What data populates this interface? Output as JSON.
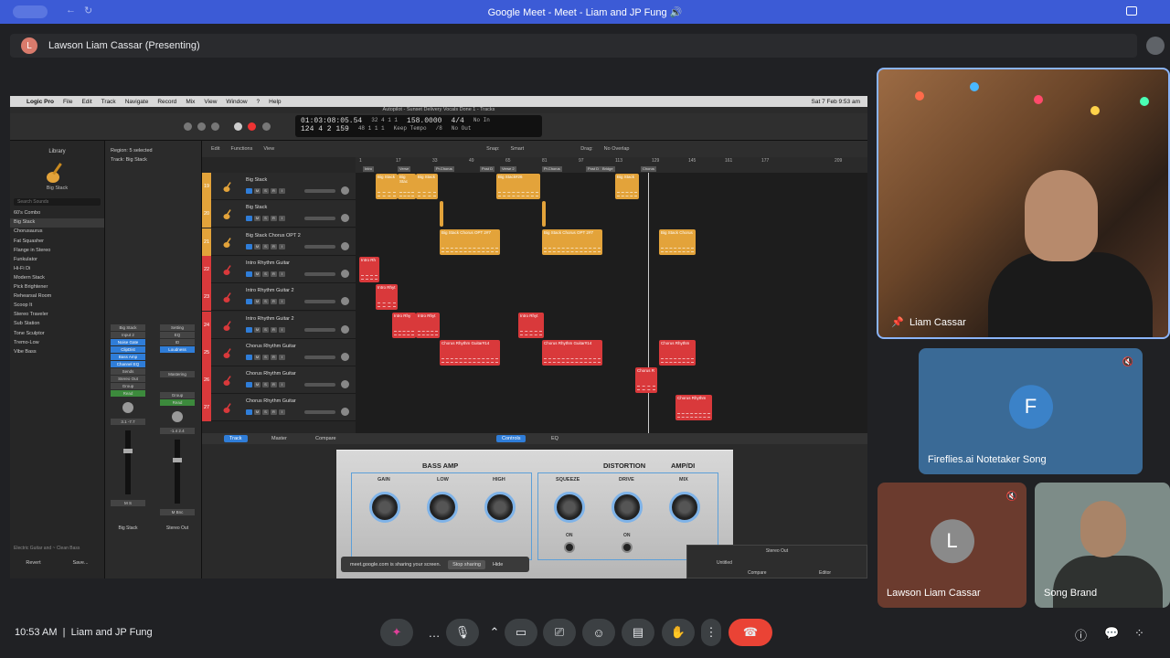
{
  "browser": {
    "title": "Google Meet - Meet - Liam and JP Fung 🔊"
  },
  "presenting": {
    "initial": "L",
    "text": "Lawson Liam Cassar (Presenting)"
  },
  "mac_menu": {
    "app": "Logic Pro",
    "items": [
      "File",
      "Edit",
      "Track",
      "Navigate",
      "Record",
      "Mix",
      "View",
      "Window",
      "?",
      "Help"
    ],
    "datetime": "Sat 7 Feb 9:53 am"
  },
  "logic": {
    "window_title": "Autopilot - Sunset Delivery Vocals Done 1 - Tracks",
    "lcd": {
      "time": "01:03:08:05.54",
      "bars": "124  4  2  159",
      "pos1": "32  4  1  1",
      "pos2": "48  1  1  1",
      "tempo": "158.0000",
      "tempo_mode": "Keep Tempo",
      "sig": "4/4",
      "sig2": "/8",
      "in": "No In",
      "out": "No Out"
    },
    "library": {
      "header": "Library",
      "patch": "Big Stack",
      "search": "Search Sounds",
      "items": [
        "60's Combo",
        "Big Stack",
        "Chorusaurus",
        "Fat Squasher",
        "Flange in Stereo",
        "Funkulator",
        "Hi-Fi Di",
        "Modern Stack",
        "Pick Brightener",
        "Rehearsal Room",
        "Scoop It",
        "Stereo Traveler",
        "Sub Station",
        "Tone Sculptor",
        "Tremo-Low",
        "Vibe Bass"
      ],
      "footer_input": "Electric Guitar and ~ Clean Bass",
      "revert": "Revert",
      "save": "Save..."
    },
    "inspector": {
      "region": "Region: 5 selected",
      "track": "Track:  Big Stack"
    },
    "strips": [
      {
        "name": "Big Stack",
        "slots": [
          "Big Stack",
          "Input 2",
          "Noise Gate",
          "ClipDist",
          "Bass Amp",
          "Channel EQ"
        ],
        "sends": "Sends",
        "out": "Stereo Out",
        "group": "Group",
        "mode": "Read",
        "vals": "3.1  -7.7",
        "ms": "M  S"
      },
      {
        "name": "Stereo Out",
        "slots": [
          "Setting",
          "EQ",
          "ID",
          "Loudness",
          "Mastering"
        ],
        "group": "Group",
        "mode": "Read",
        "vals": "-1.4  2.4",
        "ms": "M  Bnc"
      }
    ],
    "toolbar": {
      "edit": "Edit",
      "functions": "Functions",
      "view": "View",
      "snap_label": "Snap:",
      "snap": "Smart",
      "drag_label": "Drag:",
      "drag": "No Overlap"
    },
    "ruler": [
      "1",
      "17",
      "33",
      "49",
      "65",
      "81",
      "97",
      "113",
      "129",
      "145",
      "161",
      "177",
      "209"
    ],
    "markers": [
      "Intro",
      "Verse",
      "Pr.Chorus",
      "Post D",
      "Verse 2",
      "Pr.Chorus",
      "Post D",
      "Bridge",
      "Chorus"
    ],
    "tracks": [
      {
        "num": "19",
        "name": "Big Stack",
        "color": "#e3a33a"
      },
      {
        "num": "20",
        "name": "Big Stack",
        "color": "#e3a33a"
      },
      {
        "num": "21",
        "name": "Big Stack Chorus OPT 2",
        "color": "#e3a33a"
      },
      {
        "num": "22",
        "name": "Intro Rhythm Guitar",
        "color": "#d9393b"
      },
      {
        "num": "23",
        "name": "Intro Rhythm Guitar 2",
        "color": "#d9393b"
      },
      {
        "num": "24",
        "name": "Intro Rhythm Guitar 2",
        "color": "#d9393b"
      },
      {
        "num": "25",
        "name": "Chorus Rhythm Guitar",
        "color": "#d9393b"
      },
      {
        "num": "26",
        "name": "Chorus Rhythm Guitar",
        "color": "#d9393b"
      },
      {
        "num": "27",
        "name": "Chorus Rhythm Guitar",
        "color": "#d9393b"
      }
    ],
    "regions": {
      "r19a": "Big Stack",
      "r19b": "Big Stac",
      "r19c": "Big Stack",
      "r19d": "Big Stack#26",
      "r19e": "Big Stack",
      "r21a": "Big Stack Chorus OPT 2#7",
      "r21b": "Big Stack Chorus OPT 2#7",
      "r21c": "Big Stack Chorus",
      "r22": "Intro Rh",
      "r23": "Intro Rhyt",
      "r24a": "Intro Rhy",
      "r24b": "Intro Rhyt",
      "r24c": "Intro Rhyt",
      "r25a": "Chorus Rhythm Guitar#14",
      "r25b": "Chorus Rhythm Guitar#14",
      "r25c": "Chorus Rhythm",
      "r26": "Chorus R",
      "r27": "Chorus Rhythm"
    },
    "bottom_tabs": {
      "track": "Track",
      "master": "Master",
      "compare": "Compare",
      "controls": "Controls",
      "eq": "EQ"
    },
    "amp": {
      "bass_amp": "BASS AMP",
      "distortion": "DISTORTION",
      "ampdi": "AMP/DI",
      "gain": "GAIN",
      "low": "LOW",
      "high": "HIGH",
      "squeeze": "SQUEEZE",
      "drive": "DRIVE",
      "mix": "MIX",
      "on1": "ON",
      "on2": "ON"
    },
    "stereo_out": {
      "title": "Stereo Out",
      "preset": "Untitled",
      "compare": "Compare",
      "editor": "Editor"
    }
  },
  "share_notice": {
    "text": "meet.google.com is sharing your screen.",
    "stop": "Stop sharing",
    "hide": "Hide"
  },
  "participants": [
    {
      "name": "Liam Cassar"
    },
    {
      "name": "Fireflies.ai Notetaker Song",
      "initial": "F"
    },
    {
      "name": "Lawson Liam Cassar",
      "initial": "L"
    },
    {
      "name": "Song Brand"
    }
  ],
  "bottom": {
    "time": "10:53 AM",
    "separator": "|",
    "meeting": "Liam and JP Fung"
  },
  "colors": {
    "accent": "#8ab4f8",
    "end_call": "#ea4335",
    "chrome": "#3c5bd6"
  }
}
